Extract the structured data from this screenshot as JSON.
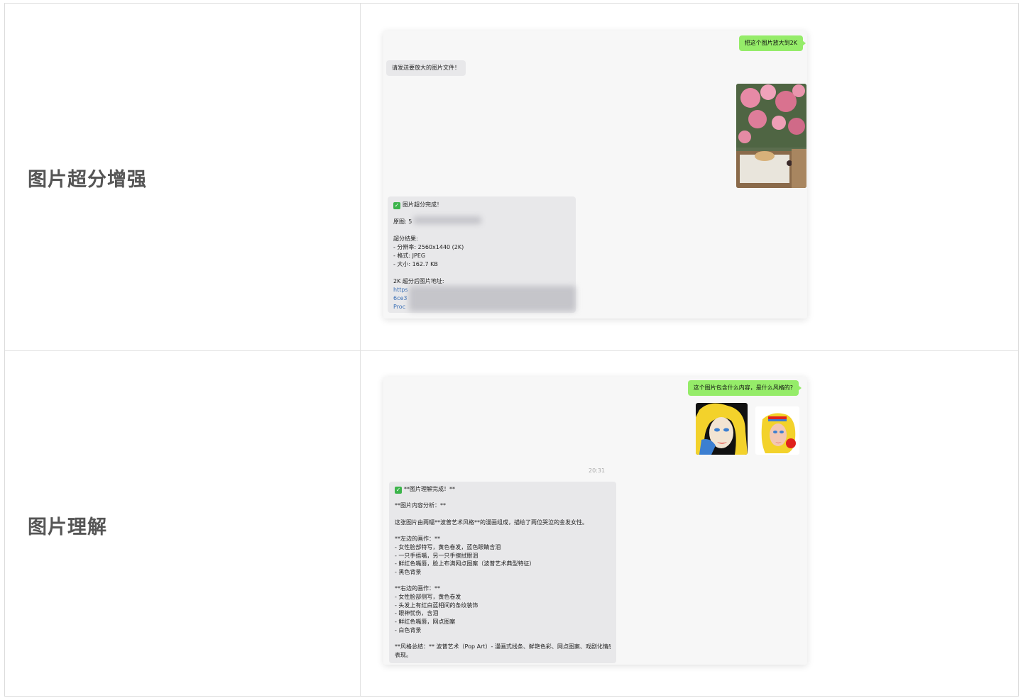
{
  "rows": [
    {
      "label": "图片超分增强",
      "chat": {
        "user_message": "把这个图片放大到2K",
        "bot_prompt": "请发送要放大的图片文件！",
        "result_title": "图片超分完成！",
        "original_label": "原图: 5",
        "result_header": "超分结果:",
        "result_lines": [
          "- 分辨率: 2560x1440 (2K)",
          "- 格式: JPEG",
          "- 大小: 162.7 KB"
        ],
        "link_header": "2K 超分后图片地址:",
        "link_lines": [
          "https",
          "6ce3",
          "Proc"
        ]
      }
    },
    {
      "label": "图片理解",
      "chat": {
        "user_message": "这个图片包含什么内容，是什么风格的?",
        "timestamp": "20:31",
        "reply_lines": [
          "**图片理解完成！**",
          "",
          "**图片内容分析：**",
          "",
          "这张图片由两幅**波普艺术风格**的漫画组成，描绘了两位哭泣的金发女性。",
          "",
          "**左边的画作：**",
          "- 女性脸部特写，黄色卷发，蓝色眼睛含泪",
          "- 一只手捂嘴，另一只手擦拭眼泪",
          "- 鲜红色嘴唇，脸上布满网点图案（波普艺术典型特征）",
          "- 黑色背景",
          "",
          "**右边的画作：**",
          "- 女性脸部侧写，黄色卷发",
          "- 头发上有红白蓝相间的条纹装饰",
          "- 眼神忧伤，含泪",
          "- 鲜红色嘴唇，网点图案",
          "- 白色背景",
          "",
          "**风格总结：** 波普艺术（Pop Art）- 漫画式线条、鲜艳色彩、网点图案、戏剧化情感",
          "表现。"
        ]
      }
    }
  ],
  "colors": {
    "user_bubble": "#95ec69",
    "bot_bubble": "#e8e8ea",
    "check": "#3cb44b",
    "link": "#3a6fb5"
  }
}
